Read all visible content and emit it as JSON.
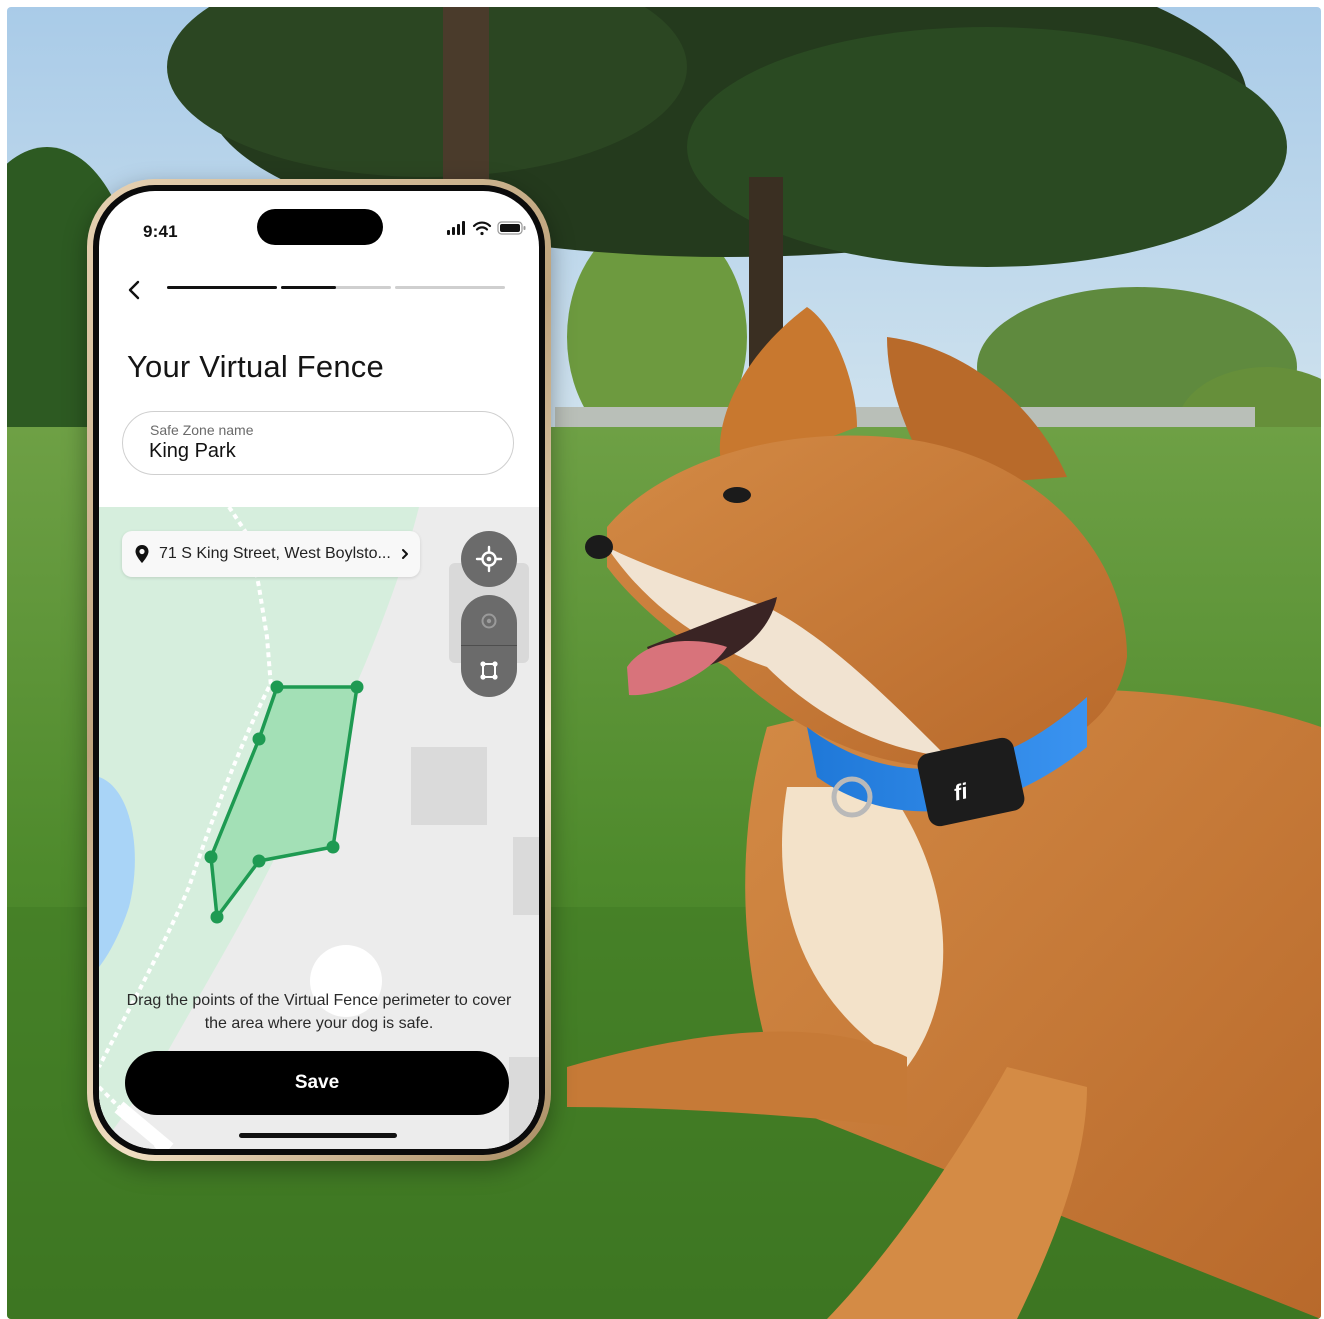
{
  "status_bar": {
    "time": "9:41"
  },
  "header": {
    "back_icon": "chevron-left-icon",
    "progress_segments": [
      1,
      0.5,
      0,
      0
    ]
  },
  "title": "Your Virtual Fence",
  "safe_zone": {
    "label": "Safe Zone name",
    "value": "King Park"
  },
  "map": {
    "address": "71 S King Street, West Boylsto...",
    "controls": [
      "locate-icon",
      "circle-mode-icon",
      "polygon-mode-icon"
    ]
  },
  "hint": "Drag the points of the Virtual Fence perimeter to cover the area where your dog is safe.",
  "save_label": "Save",
  "colors": {
    "accent": "#1e9a52",
    "fence_fill": "#a3e0b6",
    "map_green": "#d6eedd",
    "map_water": "#a9d4f7",
    "button": "#000000"
  }
}
